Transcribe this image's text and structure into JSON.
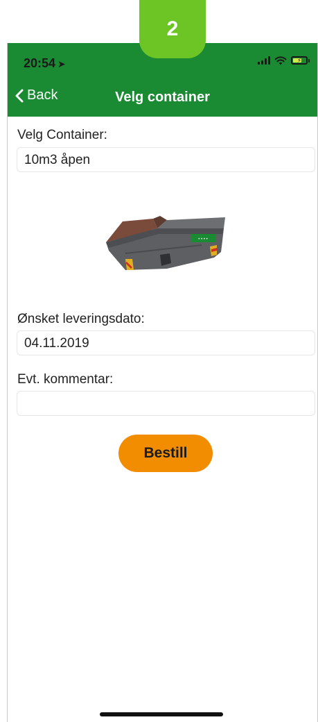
{
  "step_badge": "2",
  "status_bar": {
    "time": "20:54",
    "location_glyph": "➤",
    "icons": [
      "signal-icon",
      "wifi-icon",
      "battery-icon"
    ]
  },
  "nav": {
    "back_label": "Back",
    "title": "Velg container"
  },
  "form": {
    "container_label": "Velg Container:",
    "container_value": "10m3 åpen",
    "date_label": "Ønsket leveringsdato:",
    "date_value": "04.11.2019",
    "comment_label": "Evt. kommentar:",
    "comment_value": ""
  },
  "order_button": "Bestill",
  "colors": {
    "header_green": "#1a8a33",
    "badge_green": "#6cc524",
    "button_orange": "#f28c00",
    "container_gray": "#5e5f63"
  }
}
